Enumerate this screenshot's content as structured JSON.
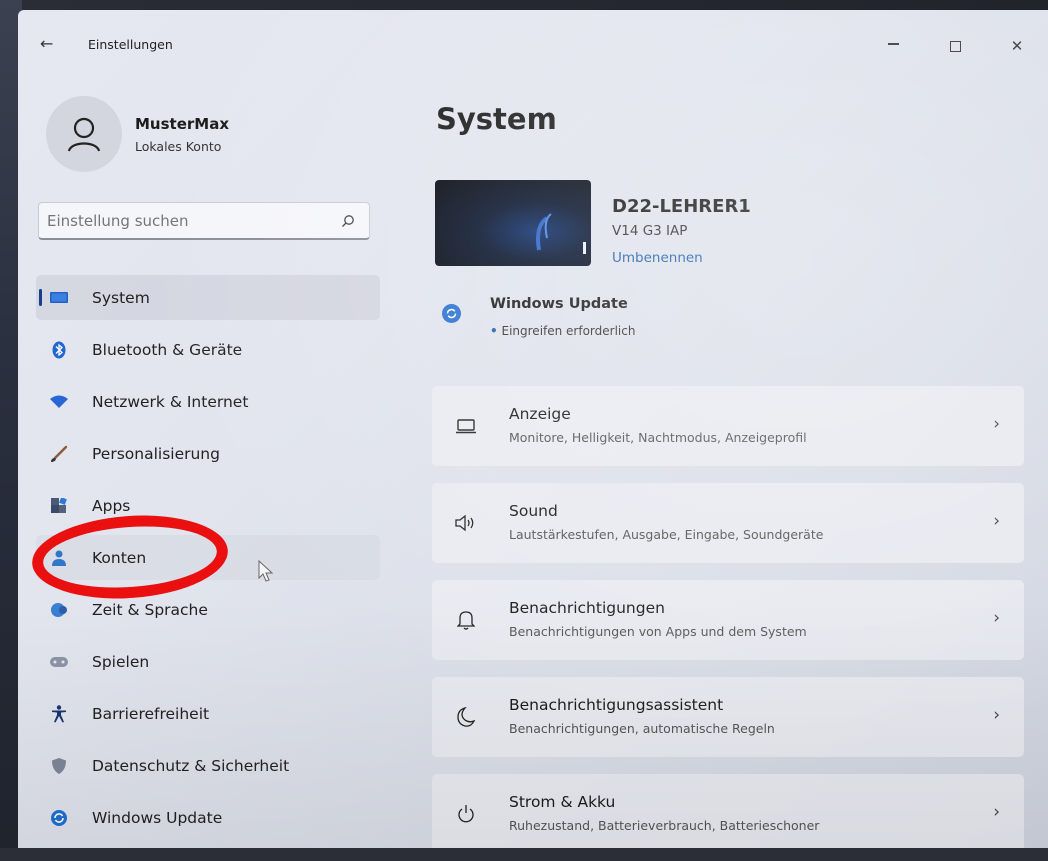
{
  "window": {
    "title": "Einstellungen",
    "back_glyph": "←",
    "close_glyph": "✕"
  },
  "profile": {
    "name": "MusterMax",
    "account_type": "Lokales Konto"
  },
  "search": {
    "placeholder": "Einstellung suchen"
  },
  "sidebar": {
    "items": [
      {
        "label": "System",
        "icon": "monitor-icon",
        "selected": true
      },
      {
        "label": "Bluetooth & Geräte",
        "icon": "bluetooth-icon"
      },
      {
        "label": "Netzwerk & Internet",
        "icon": "wifi-icon"
      },
      {
        "label": "Personalisierung",
        "icon": "brush-icon"
      },
      {
        "label": "Apps",
        "icon": "apps-icon"
      },
      {
        "label": "Konten",
        "icon": "person-icon",
        "hover": true
      },
      {
        "label": "Zeit & Sprache",
        "icon": "globe-icon"
      },
      {
        "label": "Spielen",
        "icon": "gamepad-icon"
      },
      {
        "label": "Barrierefreiheit",
        "icon": "accessibility-icon"
      },
      {
        "label": "Datenschutz & Sicherheit",
        "icon": "shield-icon"
      },
      {
        "label": "Windows Update",
        "icon": "update-icon"
      }
    ]
  },
  "main": {
    "title": "System",
    "device": {
      "name": "D22-LEHRER1",
      "model": "V14 G3 IAP",
      "rename": "Umbenennen"
    },
    "windows_update": {
      "title": "Windows Update",
      "status": "Eingreifen erforderlich"
    },
    "cards": [
      {
        "title": "Anzeige",
        "subtitle": "Monitore, Helligkeit, Nachtmodus, Anzeigeprofil",
        "icon": "display-icon"
      },
      {
        "title": "Sound",
        "subtitle": "Lautstärkestufen, Ausgabe, Eingabe, Soundgeräte",
        "icon": "speaker-icon"
      },
      {
        "title": "Benachrichtigungen",
        "subtitle": "Benachrichtigungen von Apps und dem System",
        "icon": "bell-icon"
      },
      {
        "title": "Benachrichtigungsassistent",
        "subtitle": "Benachrichtigungen, automatische Regeln",
        "icon": "moon-icon"
      },
      {
        "title": "Strom & Akku",
        "subtitle": "Ruhezustand, Batterieverbrauch, Batterieschoner",
        "icon": "power-icon"
      }
    ],
    "chevron": "›"
  },
  "colors": {
    "accent": "#1f5fa9",
    "annotation": "#ea1010"
  }
}
